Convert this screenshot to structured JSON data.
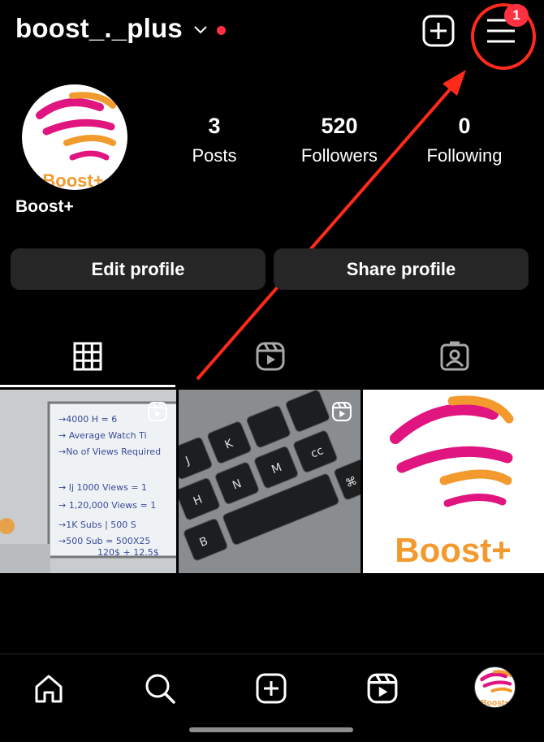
{
  "header": {
    "username": "boost_._plus",
    "notification_count": "1"
  },
  "profile": {
    "display_name": "Boost+",
    "avatar_brand": "Boost+",
    "stats": [
      {
        "value": "3",
        "label": "Posts"
      },
      {
        "value": "520",
        "label": "Followers"
      },
      {
        "value": "0",
        "label": "Following"
      }
    ]
  },
  "actions": {
    "edit_label": "Edit profile",
    "share_label": "Share profile"
  },
  "tabs": [
    {
      "icon": "grid-icon",
      "active": true
    },
    {
      "icon": "reels-icon",
      "active": false
    },
    {
      "icon": "tagged-icon",
      "active": false
    }
  ],
  "posts": [
    {
      "type": "reel",
      "whiteboard_lines": [
        "→4000 H = 6",
        "→ Average Watch Ti",
        "→No of Views Required",
        "→ Ij 1000 Views = 1",
        "→ 1,20,000 Views = 1",
        "→1K Subs | 500 S",
        "→500 Sub = 500X25",
        "120$ + 12.5$"
      ]
    },
    {
      "type": "reel",
      "keys": [
        "J",
        "K",
        "H",
        "M",
        "N",
        "B",
        "⌘",
        "cc"
      ]
    },
    {
      "type": "image",
      "brand": "Boost+"
    }
  ],
  "nav": [
    {
      "icon": "home-icon"
    },
    {
      "icon": "search-icon"
    },
    {
      "icon": "create-icon"
    },
    {
      "icon": "reels-icon"
    },
    {
      "icon": "profile-avatar"
    }
  ],
  "colors": {
    "background": "#000000",
    "button_bg": "#262626",
    "badge_red": "#ff3040",
    "annotation_red": "#ff2a1a",
    "brand_pink": "#e0157f",
    "brand_orange": "#f29a2e"
  }
}
